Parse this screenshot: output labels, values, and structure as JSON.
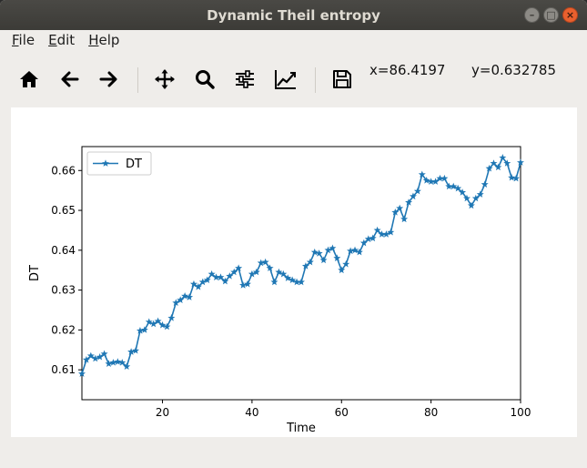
{
  "window": {
    "title": "Dynamic Theil entropy",
    "controls": {
      "minimize": "–",
      "maximize": "□",
      "close": "×"
    }
  },
  "menubar": {
    "items": [
      {
        "mnemonic": "F",
        "rest": "ile"
      },
      {
        "mnemonic": "E",
        "rest": "dit"
      },
      {
        "mnemonic": "H",
        "rest": "elp"
      }
    ]
  },
  "toolbar": {
    "buttons": [
      "home-icon",
      "back-arrow-icon",
      "forward-arrow-icon",
      "pan-move-icon",
      "zoom-magnifier-icon",
      "configure-subplots-icon",
      "edit-axis-curves-icon",
      "save-disk-icon"
    ]
  },
  "status": {
    "x": "x=86.4197",
    "y": "y=0.632785"
  },
  "chart_data": {
    "type": "line",
    "xlabel": "Time",
    "ylabel": "DT",
    "xlim": [
      2,
      100
    ],
    "ylim": [
      0.6025,
      0.666
    ],
    "xticks": [
      20,
      40,
      60,
      80,
      100
    ],
    "yticks": [
      0.61,
      0.62,
      0.63,
      0.64,
      0.65,
      0.66
    ],
    "xtick_labels": [
      "20",
      "40",
      "60",
      "80",
      "100"
    ],
    "ytick_labels": [
      "0.61",
      "0.62",
      "0.63",
      "0.64",
      "0.65",
      "0.66"
    ],
    "grid": false,
    "legend": {
      "position": "top-left",
      "entries": [
        "DT"
      ]
    },
    "series": [
      {
        "name": "DT",
        "color": "#1f77b4",
        "marker": "star",
        "x": [
          2,
          3,
          4,
          5,
          6,
          7,
          8,
          9,
          10,
          11,
          12,
          13,
          14,
          15,
          16,
          17,
          18,
          19,
          20,
          21,
          22,
          23,
          24,
          25,
          26,
          27,
          28,
          29,
          30,
          31,
          32,
          33,
          34,
          35,
          36,
          37,
          38,
          39,
          40,
          41,
          42,
          43,
          44,
          45,
          46,
          47,
          48,
          49,
          50,
          51,
          52,
          53,
          54,
          55,
          56,
          57,
          58,
          59,
          60,
          61,
          62,
          63,
          64,
          65,
          66,
          67,
          68,
          69,
          70,
          71,
          72,
          73,
          74,
          75,
          76,
          77,
          78,
          79,
          80,
          81,
          82,
          83,
          84,
          85,
          86,
          87,
          88,
          89,
          90,
          91,
          92,
          93,
          94,
          95,
          96,
          97,
          98,
          99,
          100
        ],
        "values": [
          0.609,
          0.6125,
          0.6135,
          0.6128,
          0.6132,
          0.614,
          0.6115,
          0.6118,
          0.612,
          0.6118,
          0.6108,
          0.6145,
          0.6148,
          0.6198,
          0.62,
          0.622,
          0.6215,
          0.6222,
          0.6212,
          0.6208,
          0.623,
          0.6268,
          0.6275,
          0.6285,
          0.6282,
          0.6315,
          0.6308,
          0.632,
          0.6325,
          0.634,
          0.6332,
          0.6332,
          0.6322,
          0.6335,
          0.6345,
          0.6355,
          0.6312,
          0.6315,
          0.634,
          0.6345,
          0.6368,
          0.637,
          0.6355,
          0.632,
          0.6345,
          0.634,
          0.633,
          0.6325,
          0.632,
          0.632,
          0.636,
          0.637,
          0.6395,
          0.6392,
          0.6375,
          0.64,
          0.6405,
          0.638,
          0.635,
          0.6365,
          0.6398,
          0.64,
          0.6395,
          0.6418,
          0.6428,
          0.643,
          0.645,
          0.644,
          0.644,
          0.6445,
          0.6495,
          0.6505,
          0.6478,
          0.652,
          0.6535,
          0.6548,
          0.659,
          0.6575,
          0.6572,
          0.6572,
          0.658,
          0.658,
          0.656,
          0.656,
          0.6555,
          0.6545,
          0.653,
          0.6512,
          0.653,
          0.654,
          0.6565,
          0.6605,
          0.6618,
          0.6608,
          0.6632,
          0.6618,
          0.6582,
          0.658,
          0.662
        ]
      }
    ]
  }
}
